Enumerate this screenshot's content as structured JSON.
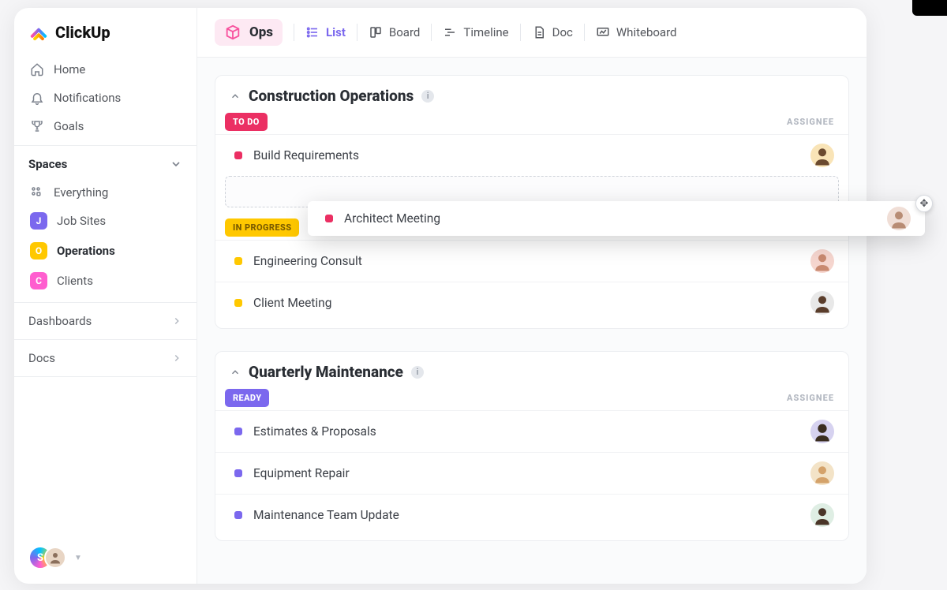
{
  "brand": "ClickUp",
  "nav": {
    "home": "Home",
    "notifications": "Notifications",
    "goals": "Goals"
  },
  "spaces_header": "Spaces",
  "spaces": {
    "everything": "Everything",
    "items": [
      {
        "letter": "J",
        "label": "Job Sites",
        "color": "#7b68ee"
      },
      {
        "letter": "O",
        "label": "Operations",
        "color": "#ffc800"
      },
      {
        "letter": "C",
        "label": "Clients",
        "color": "#ff5ecf"
      }
    ]
  },
  "dashboards_label": "Dashboards",
  "docs_label": "Docs",
  "user_initial": "S",
  "topbar": {
    "space_name": "Ops",
    "views": {
      "list": "List",
      "board": "Board",
      "timeline": "Timeline",
      "doc": "Doc",
      "whiteboard": "Whiteboard"
    }
  },
  "lists": [
    {
      "title": "Construction Operations",
      "groups": [
        {
          "status": "TO DO",
          "color": "#eb2f63",
          "assignee_header": "ASSIGNEE",
          "tasks": [
            {
              "name": "Build Requirements",
              "dot": "#eb2f63",
              "avatar_bg": "#f9e4b7"
            }
          ],
          "drop_zone": true
        },
        {
          "status": "IN PROGRESS",
          "color": "#ffc800",
          "tasks": [
            {
              "name": "Engineering Consult",
              "dot": "#ffc800",
              "avatar_bg": "#f6d6cf"
            },
            {
              "name": "Client Meeting",
              "dot": "#ffc800",
              "avatar_bg": "#e8e8e8"
            }
          ]
        }
      ]
    },
    {
      "title": "Quarterly Maintenance",
      "groups": [
        {
          "status": "READY",
          "color": "#7b68ee",
          "assignee_header": "ASSIGNEE",
          "tasks": [
            {
              "name": "Estimates & Proposals",
              "dot": "#7b68ee",
              "avatar_bg": "#d6d2f0"
            },
            {
              "name": "Equipment Repair",
              "dot": "#7b68ee",
              "avatar_bg": "#f3e3c7"
            },
            {
              "name": "Maintenance Team Update",
              "dot": "#7b68ee",
              "avatar_bg": "#dfeee4"
            }
          ]
        }
      ]
    }
  ],
  "dragging_task": {
    "name": "Architect Meeting",
    "dot": "#eb2f63",
    "avatar_bg": "#f0ded6"
  }
}
